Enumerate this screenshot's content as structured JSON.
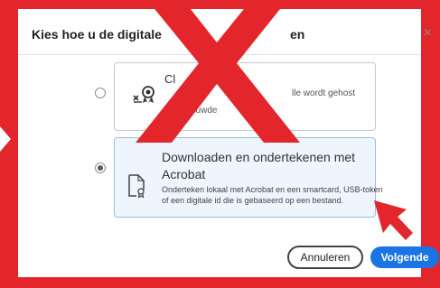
{
  "dialog": {
    "title": "Kies hoe u de digitale",
    "title_tail": "en",
    "close_glyph": "×"
  },
  "options": [
    {
      "title": "Cl",
      "desc_tail": "lle wordt gehost",
      "desc_line2": "ouwde",
      "selected": false
    },
    {
      "title": "Downloaden en ondertekenen met Acrobat",
      "desc": "Onderteken lokaal met Acrobat en een smartcard, USB-token of een digitale id die is gebaseerd op een bestand.",
      "selected": true
    }
  ],
  "buttons": {
    "cancel": "Annuleren",
    "next": "Volgende"
  },
  "colors": {
    "red_overlay": "#e3262b",
    "primary": "#1b74e4",
    "selected_bg": "#eef5fd"
  },
  "icons": {
    "option1": "cloud-certificate-icon",
    "option2": "document-certificate-icon",
    "overlay": "red-x-mark",
    "pointer": "red-arrow-pointer"
  }
}
